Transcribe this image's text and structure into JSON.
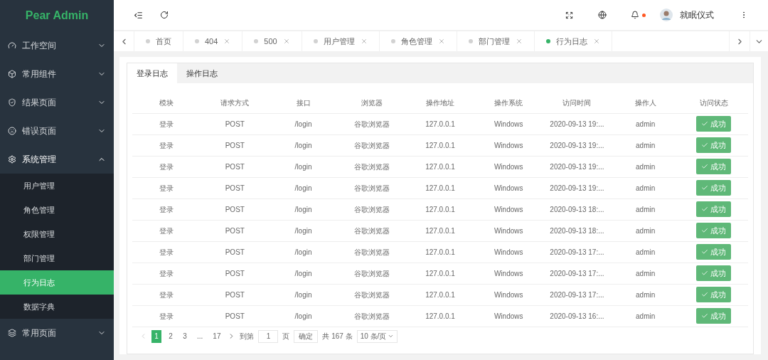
{
  "brand": "Pear Admin",
  "menu": [
    {
      "label": "工作空间",
      "expanded": false
    },
    {
      "label": "常用组件",
      "expanded": false
    },
    {
      "label": "结果页面",
      "expanded": false
    },
    {
      "label": "错误页面",
      "expanded": false
    },
    {
      "label": "系统管理",
      "expanded": true,
      "children": [
        {
          "label": "用户管理",
          "selected": false
        },
        {
          "label": "角色管理",
          "selected": false
        },
        {
          "label": "权限管理",
          "selected": false
        },
        {
          "label": "部门管理",
          "selected": false
        },
        {
          "label": "行为日志",
          "selected": true
        },
        {
          "label": "数据字典",
          "selected": false
        }
      ]
    },
    {
      "label": "常用页面",
      "expanded": false
    }
  ],
  "header": {
    "user": "就眠仪式",
    "notification": true
  },
  "page_tabs": [
    {
      "label": "首页",
      "closable": false,
      "selected": false
    },
    {
      "label": "404",
      "closable": true,
      "selected": false
    },
    {
      "label": "500",
      "closable": true,
      "selected": false
    },
    {
      "label": "用户管理",
      "closable": true,
      "selected": false
    },
    {
      "label": "角色管理",
      "closable": true,
      "selected": false
    },
    {
      "label": "部门管理",
      "closable": true,
      "selected": false
    },
    {
      "label": "行为日志",
      "closable": true,
      "selected": true
    }
  ],
  "log_tabs": [
    {
      "label": "登录日志",
      "selected": true
    },
    {
      "label": "操作日志",
      "selected": false
    }
  ],
  "table": {
    "columns": [
      "模块",
      "请求方式",
      "接口",
      "浏览器",
      "操作地址",
      "操作系统",
      "访问时间",
      "操作人",
      "访问状态"
    ],
    "rows": [
      {
        "cells": [
          "登录",
          "POST",
          "/login",
          "谷歌浏览器",
          "127.0.0.1",
          "Windows",
          "2020-09-13 19:...",
          "admin"
        ],
        "status": "成功"
      },
      {
        "cells": [
          "登录",
          "POST",
          "/login",
          "谷歌浏览器",
          "127.0.0.1",
          "Windows",
          "2020-09-13 19:...",
          "admin"
        ],
        "status": "成功"
      },
      {
        "cells": [
          "登录",
          "POST",
          "/login",
          "谷歌浏览器",
          "127.0.0.1",
          "Windows",
          "2020-09-13 19:...",
          "admin"
        ],
        "status": "成功"
      },
      {
        "cells": [
          "登录",
          "POST",
          "/login",
          "谷歌浏览器",
          "127.0.0.1",
          "Windows",
          "2020-09-13 19:...",
          "admin"
        ],
        "status": "成功"
      },
      {
        "cells": [
          "登录",
          "POST",
          "/login",
          "谷歌浏览器",
          "127.0.0.1",
          "Windows",
          "2020-09-13 18:...",
          "admin"
        ],
        "status": "成功"
      },
      {
        "cells": [
          "登录",
          "POST",
          "/login",
          "谷歌浏览器",
          "127.0.0.1",
          "Windows",
          "2020-09-13 18:...",
          "admin"
        ],
        "status": "成功"
      },
      {
        "cells": [
          "登录",
          "POST",
          "/login",
          "谷歌浏览器",
          "127.0.0.1",
          "Windows",
          "2020-09-13 17:...",
          "admin"
        ],
        "status": "成功"
      },
      {
        "cells": [
          "登录",
          "POST",
          "/login",
          "谷歌浏览器",
          "127.0.0.1",
          "Windows",
          "2020-09-13 17:...",
          "admin"
        ],
        "status": "成功"
      },
      {
        "cells": [
          "登录",
          "POST",
          "/login",
          "谷歌浏览器",
          "127.0.0.1",
          "Windows",
          "2020-09-13 17:...",
          "admin"
        ],
        "status": "成功"
      },
      {
        "cells": [
          "登录",
          "POST",
          "/login",
          "谷歌浏览器",
          "127.0.0.1",
          "Windows",
          "2020-09-13 16:...",
          "admin"
        ],
        "status": "成功"
      }
    ]
  },
  "pagination": {
    "pages": [
      {
        "label": "1",
        "selected": true
      },
      {
        "label": "2",
        "selected": false
      },
      {
        "label": "3",
        "selected": false
      },
      {
        "label": "...",
        "selected": false
      },
      {
        "label": "17",
        "selected": false
      }
    ],
    "goto_label": "到第",
    "goto_value": "1",
    "page_unit": "页",
    "confirm": "确定",
    "total": "共 167 条",
    "page_size": "10 条/页"
  }
}
